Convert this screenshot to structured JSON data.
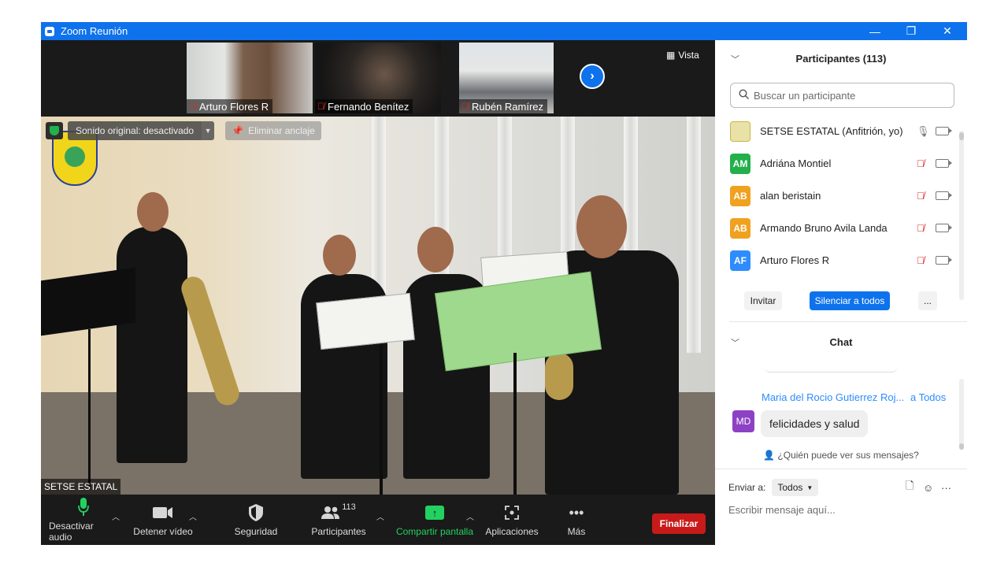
{
  "window": {
    "title": "Zoom Reunión",
    "min": "—",
    "restore": "❐",
    "close": "✕"
  },
  "thumbnails": [
    {
      "name": "Arturo Flores R",
      "muted": true
    },
    {
      "name": "Fernando Benítez",
      "muted": true
    },
    {
      "name": "Rubén Ramírez",
      "muted": true
    }
  ],
  "view": {
    "label": "Vista"
  },
  "main_video": {
    "sound_label": "Sonido original: desactivado",
    "unpin_label": "Eliminar anclaje",
    "speaker_tag": "SETSE ESTATAL"
  },
  "toolbar": {
    "audio": "Desactivar audio",
    "video": "Detener vídeo",
    "security": "Seguridad",
    "participants": "Participantes",
    "participants_count": "113",
    "share": "Compartir pantalla",
    "apps": "Aplicaciones",
    "more": "Más",
    "end": "Finalizar"
  },
  "participants_panel": {
    "title": "Participantes (113)",
    "search_placeholder": "Buscar un participante",
    "rows": [
      {
        "initials": "",
        "name": "SETSE ESTATAL (Anfitrión, yo)",
        "color": "#e9e2a8",
        "muted": false
      },
      {
        "initials": "AM",
        "name": "Adriána Montiel",
        "color": "#23b04b",
        "muted": true
      },
      {
        "initials": "AB",
        "name": "alan beristain",
        "color": "#f0a11f",
        "muted": true
      },
      {
        "initials": "AB",
        "name": "Armando Bruno Avila Landa",
        "color": "#f0a11f",
        "muted": true
      },
      {
        "initials": "AF",
        "name": "Arturo Flores R",
        "color": "#2d8cff",
        "muted": true
      }
    ],
    "invite": "Invitar",
    "mute_all": "Silenciar a todos",
    "more": "..."
  },
  "chat_panel": {
    "title": "Chat",
    "message": {
      "initials": "MD",
      "avatar_color": "#8d41c4",
      "sender": "Maria del Rocio Gutierrez Roj...",
      "to": "a Todos",
      "text": "felicidades y salud"
    },
    "who_can_see": "¿Quién puede ver sus mensajes?",
    "send_to_label": "Enviar a:",
    "send_to_value": "Todos",
    "compose_placeholder": "Escribir mensaje aquí..."
  }
}
